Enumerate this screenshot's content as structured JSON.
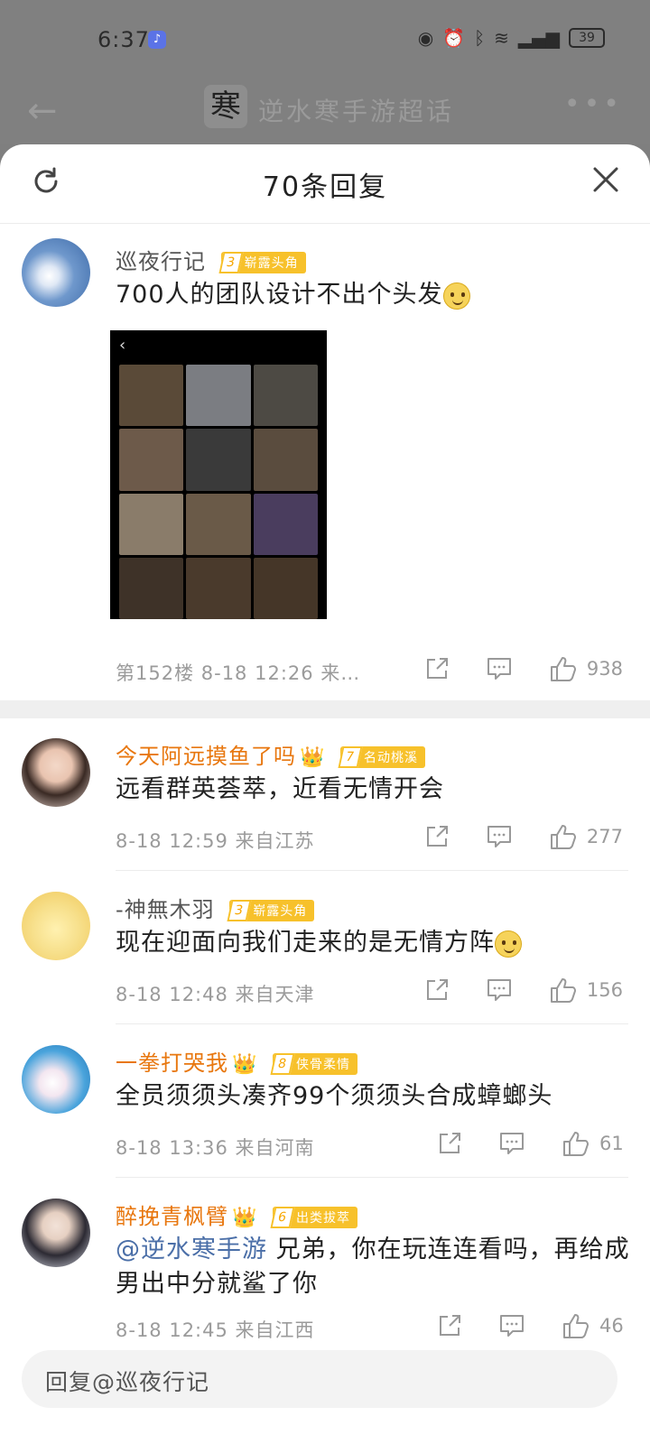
{
  "status_bar": {
    "time": "6:37",
    "battery": "39"
  },
  "topbar": {
    "title": "逆水寒手游超话",
    "logo_char": "寒"
  },
  "sheet": {
    "title": "70条回复"
  },
  "main_comment": {
    "username": "巡夜行记",
    "badge_level": "3",
    "badge_text": "崭露头角",
    "text": "700人的团队设计不出个头发",
    "meta": "第152楼 8-18 12:26 来…",
    "likes": "938"
  },
  "replies": [
    {
      "username": "今天阿远摸鱼了吗",
      "badge_level": "7",
      "badge_text": "名动桃溪",
      "text": "远看群英荟萃，近看无情开会",
      "meta": "8-18 12:59 来自江苏",
      "likes": "277"
    },
    {
      "username": "-神無木羽",
      "badge_level": "3",
      "badge_text": "崭露头角",
      "text": "现在迎面向我们走来的是无情方阵",
      "meta": "8-18 12:48 来自天津",
      "likes": "156"
    },
    {
      "username": "一拳打哭我",
      "badge_level": "8",
      "badge_text": "侠骨柔情",
      "text": "全员须须头凑齐99个须须头合成蟑螂头",
      "meta": "8-18 13:36 来自河南",
      "likes": "61"
    },
    {
      "username": "醉挽青枫臂",
      "badge_level": "6",
      "badge_text": "出类拔萃",
      "mention": "@逆水寒手游",
      "text": " 兄弟，你在玩连连看吗，再给成男出中分就鲨了你",
      "meta": "8-18 12:45 来自江西",
      "likes": "46"
    }
  ],
  "reply_input": {
    "placeholder": "回复@巡夜行记"
  },
  "colors": {
    "vip_name": "#e8770f",
    "badge": "#f7c12b",
    "mention": "#4b6fa8"
  }
}
